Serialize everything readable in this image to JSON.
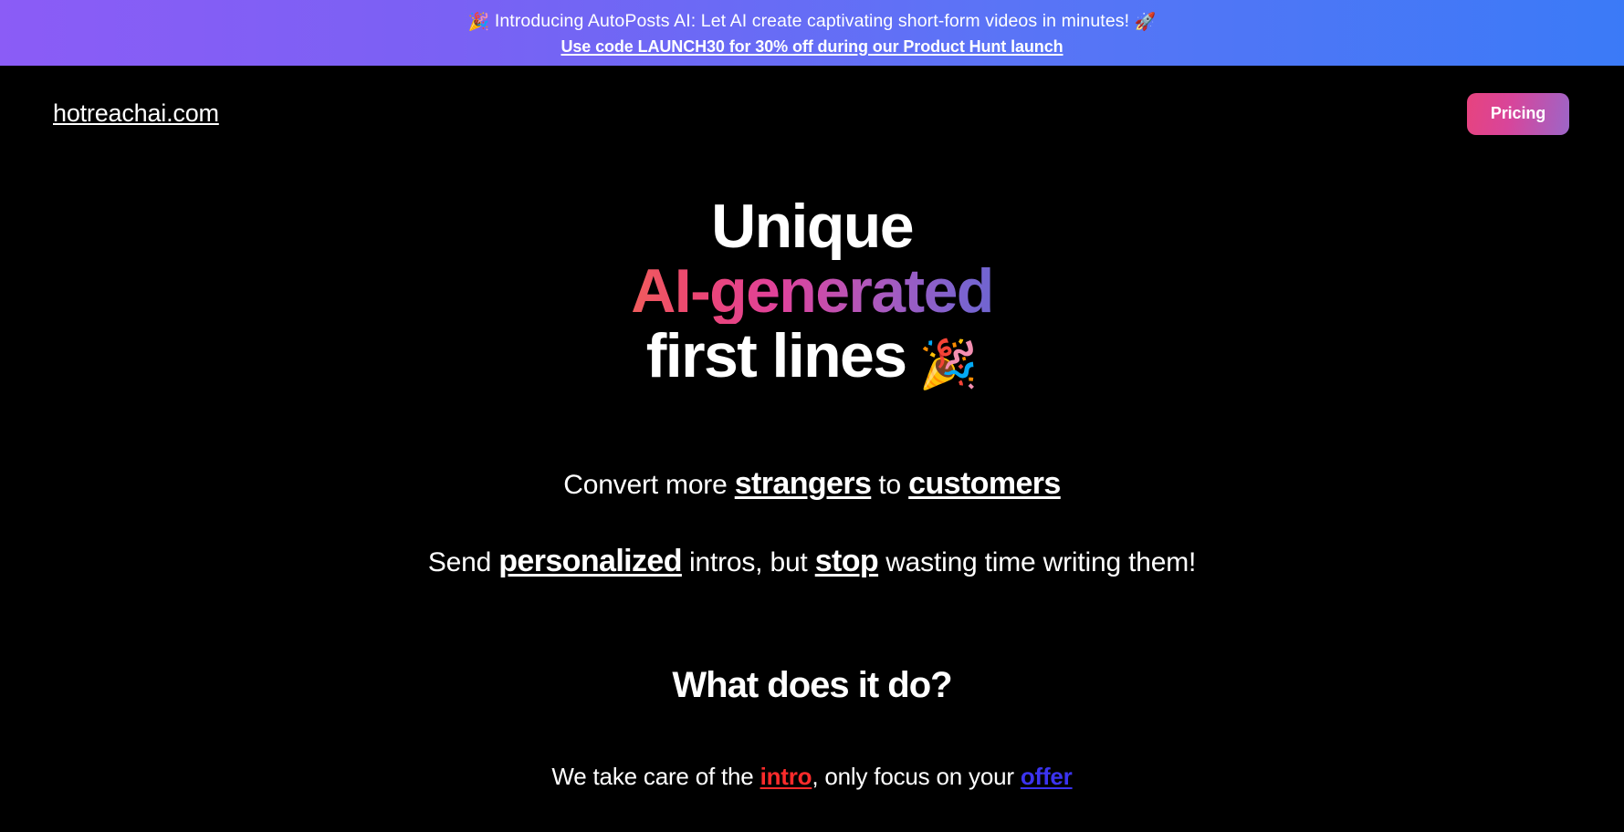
{
  "promo_banner": {
    "emoji_left": "🎉",
    "line_1": "Introducing AutoPosts AI: Let AI create captivating short-form videos in minutes!",
    "emoji_right": "🚀",
    "line_2": "Use code LAUNCH30 for 30% off during our Product Hunt launch",
    "gradient_from": "#8b5cf6",
    "gradient_to": "#3b7af7"
  },
  "header": {
    "logo": "hotreachai.com",
    "pricing_label": "Pricing",
    "pricing_gradient_from": "#e7437e",
    "pricing_gradient_to": "#9c66c8"
  },
  "hero": {
    "line_1": "Unique",
    "line_2": "AI-generated",
    "line_3": "first lines",
    "emoji": "🎉",
    "gradient_from": "#f05c5c",
    "gradient_to": "#7065d0",
    "sub_1": {
      "prefix": "Convert more ",
      "emph_1": "strangers",
      "middle": " to ",
      "emph_2": "customers"
    },
    "sub_2": {
      "prefix": "Send ",
      "emph_1": "personalized",
      "middle": " intros, but ",
      "emph_2": "stop",
      "suffix": " wasting time writing them!"
    }
  },
  "section": {
    "heading": "What does it do?",
    "body": {
      "prefix": "We take care of the ",
      "link_1": "intro",
      "middle": ", only focus on your ",
      "link_2": "offer",
      "link_1_color": "#fb2b2b",
      "link_2_color": "#3b33f0"
    }
  }
}
